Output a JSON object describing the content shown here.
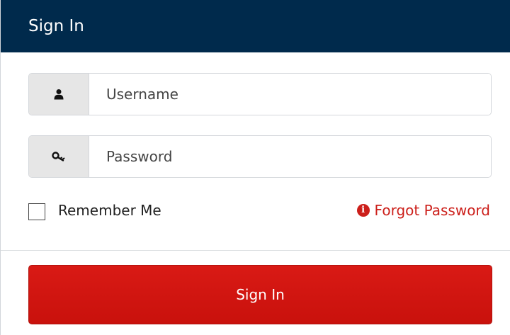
{
  "header": {
    "title": "Sign In"
  },
  "form": {
    "username": {
      "icon": "user-icon",
      "placeholder": "Username",
      "value": ""
    },
    "password": {
      "icon": "key-icon",
      "placeholder": "Password",
      "value": ""
    },
    "remember_me": {
      "label": "Remember Me",
      "checked": false
    },
    "forgot_password": {
      "icon": "info-icon",
      "label": "Forgot Password"
    },
    "submit_label": "Sign In"
  },
  "colors": {
    "header_bg": "#002a4c",
    "accent_red": "#cc1f1a",
    "addon_bg": "#e6e6e6"
  }
}
